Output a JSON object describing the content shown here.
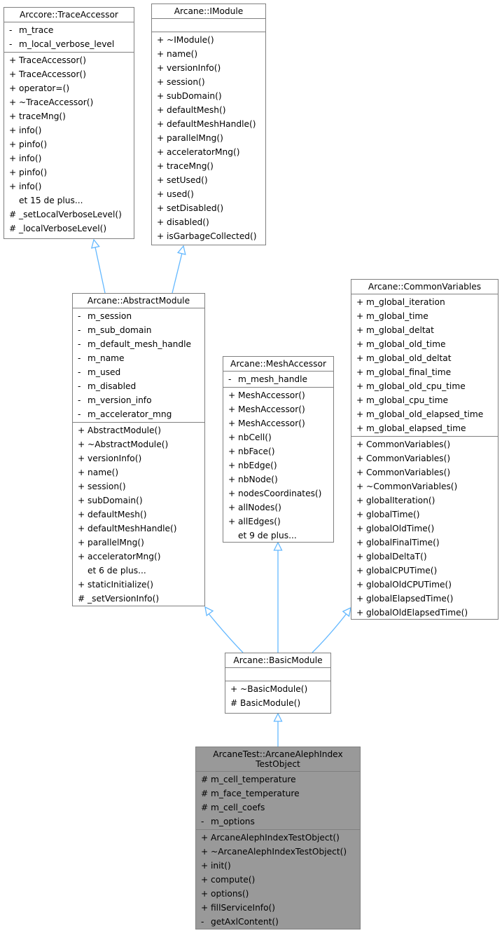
{
  "diagram": {
    "edge_color": "#63b8ff",
    "classes": {
      "trace_accessor": {
        "title": "Arccore::TraceAccessor",
        "attributes": [
          {
            "vis": "-",
            "name": "m_trace"
          },
          {
            "vis": "-",
            "name": "m_local_verbose_level"
          }
        ],
        "methods": [
          {
            "vis": "+",
            "name": "TraceAccessor()"
          },
          {
            "vis": "+",
            "name": "TraceAccessor()"
          },
          {
            "vis": "+",
            "name": "operator=()"
          },
          {
            "vis": "+",
            "name": "~TraceAccessor()"
          },
          {
            "vis": "+",
            "name": "traceMng()"
          },
          {
            "vis": "+",
            "name": "info()"
          },
          {
            "vis": "+",
            "name": "pinfo()"
          },
          {
            "vis": "+",
            "name": "info()"
          },
          {
            "vis": "+",
            "name": "pinfo()"
          },
          {
            "vis": "+",
            "name": "info()"
          },
          {
            "vis": "",
            "name": "et 15 de plus..."
          },
          {
            "vis": "#",
            "name": "_setLocalVerboseLevel()"
          },
          {
            "vis": "#",
            "name": "_localVerboseLevel()"
          }
        ]
      },
      "imodule": {
        "title": "Arcane::IModule",
        "attributes": [],
        "methods": [
          {
            "vis": "+",
            "name": "~IModule()"
          },
          {
            "vis": "+",
            "name": "name()"
          },
          {
            "vis": "+",
            "name": "versionInfo()"
          },
          {
            "vis": "+",
            "name": "session()"
          },
          {
            "vis": "+",
            "name": "subDomain()"
          },
          {
            "vis": "+",
            "name": "defaultMesh()"
          },
          {
            "vis": "+",
            "name": "defaultMeshHandle()"
          },
          {
            "vis": "+",
            "name": "parallelMng()"
          },
          {
            "vis": "+",
            "name": "acceleratorMng()"
          },
          {
            "vis": "+",
            "name": "traceMng()"
          },
          {
            "vis": "+",
            "name": "setUsed()"
          },
          {
            "vis": "+",
            "name": "used()"
          },
          {
            "vis": "+",
            "name": "setDisabled()"
          },
          {
            "vis": "+",
            "name": "disabled()"
          },
          {
            "vis": "+",
            "name": "isGarbageCollected()"
          }
        ]
      },
      "abstract_module": {
        "title": "Arcane::AbstractModule",
        "attributes": [
          {
            "vis": "-",
            "name": "m_session"
          },
          {
            "vis": "-",
            "name": "m_sub_domain"
          },
          {
            "vis": "-",
            "name": "m_default_mesh_handle"
          },
          {
            "vis": "-",
            "name": "m_name"
          },
          {
            "vis": "-",
            "name": "m_used"
          },
          {
            "vis": "-",
            "name": "m_disabled"
          },
          {
            "vis": "-",
            "name": "m_version_info"
          },
          {
            "vis": "-",
            "name": "m_accelerator_mng"
          }
        ],
        "methods": [
          {
            "vis": "+",
            "name": "AbstractModule()"
          },
          {
            "vis": "+",
            "name": "~AbstractModule()"
          },
          {
            "vis": "+",
            "name": "versionInfo()"
          },
          {
            "vis": "+",
            "name": "name()"
          },
          {
            "vis": "+",
            "name": "session()"
          },
          {
            "vis": "+",
            "name": "subDomain()"
          },
          {
            "vis": "+",
            "name": "defaultMesh()"
          },
          {
            "vis": "+",
            "name": "defaultMeshHandle()"
          },
          {
            "vis": "+",
            "name": "parallelMng()"
          },
          {
            "vis": "+",
            "name": "acceleratorMng()"
          },
          {
            "vis": "",
            "name": "et 6 de plus..."
          },
          {
            "vis": "+",
            "name": "staticInitialize()"
          },
          {
            "vis": "#",
            "name": "_setVersionInfo()"
          }
        ]
      },
      "mesh_accessor": {
        "title": "Arcane::MeshAccessor",
        "attributes": [
          {
            "vis": "-",
            "name": "m_mesh_handle"
          }
        ],
        "methods": [
          {
            "vis": "+",
            "name": "MeshAccessor()"
          },
          {
            "vis": "+",
            "name": "MeshAccessor()"
          },
          {
            "vis": "+",
            "name": "MeshAccessor()"
          },
          {
            "vis": "+",
            "name": "nbCell()"
          },
          {
            "vis": "+",
            "name": "nbFace()"
          },
          {
            "vis": "+",
            "name": "nbEdge()"
          },
          {
            "vis": "+",
            "name": "nbNode()"
          },
          {
            "vis": "+",
            "name": "nodesCoordinates()"
          },
          {
            "vis": "+",
            "name": "allNodes()"
          },
          {
            "vis": "+",
            "name": "allEdges()"
          },
          {
            "vis": "",
            "name": "et 9 de plus..."
          }
        ]
      },
      "common_variables": {
        "title": "Arcane::CommonVariables",
        "attributes": [
          {
            "vis": "+",
            "name": "m_global_iteration"
          },
          {
            "vis": "+",
            "name": "m_global_time"
          },
          {
            "vis": "+",
            "name": "m_global_deltat"
          },
          {
            "vis": "+",
            "name": "m_global_old_time"
          },
          {
            "vis": "+",
            "name": "m_global_old_deltat"
          },
          {
            "vis": "+",
            "name": "m_global_final_time"
          },
          {
            "vis": "+",
            "name": "m_global_old_cpu_time"
          },
          {
            "vis": "+",
            "name": "m_global_cpu_time"
          },
          {
            "vis": "+",
            "name": "m_global_old_elapsed_time"
          },
          {
            "vis": "+",
            "name": "m_global_elapsed_time"
          }
        ],
        "methods": [
          {
            "vis": "+",
            "name": "CommonVariables()"
          },
          {
            "vis": "+",
            "name": "CommonVariables()"
          },
          {
            "vis": "+",
            "name": "CommonVariables()"
          },
          {
            "vis": "+",
            "name": "~CommonVariables()"
          },
          {
            "vis": "+",
            "name": "globalIteration()"
          },
          {
            "vis": "+",
            "name": "globalTime()"
          },
          {
            "vis": "+",
            "name": "globalOldTime()"
          },
          {
            "vis": "+",
            "name": "globalFinalTime()"
          },
          {
            "vis": "+",
            "name": "globalDeltaT()"
          },
          {
            "vis": "+",
            "name": "globalCPUTime()"
          },
          {
            "vis": "+",
            "name": "globalOldCPUTime()"
          },
          {
            "vis": "+",
            "name": "globalElapsedTime()"
          },
          {
            "vis": "+",
            "name": "globalOldElapsedTime()"
          }
        ]
      },
      "basic_module": {
        "title": "Arcane::BasicModule",
        "attributes": [],
        "methods": [
          {
            "vis": "+",
            "name": "~BasicModule()"
          },
          {
            "vis": "#",
            "name": "BasicModule()"
          }
        ]
      },
      "test_object": {
        "title": "ArcaneTest::ArcaneAlephIndex\nTestObject",
        "attributes": [
          {
            "vis": "#",
            "name": "m_cell_temperature"
          },
          {
            "vis": "#",
            "name": "m_face_temperature"
          },
          {
            "vis": "#",
            "name": "m_cell_coefs"
          },
          {
            "vis": "-",
            "name": "m_options"
          }
        ],
        "methods": [
          {
            "vis": "+",
            "name": "ArcaneAlephIndexTestObject()"
          },
          {
            "vis": "+",
            "name": "~ArcaneAlephIndexTestObject()"
          },
          {
            "vis": "+",
            "name": "init()"
          },
          {
            "vis": "+",
            "name": "compute()"
          },
          {
            "vis": "+",
            "name": "options()"
          },
          {
            "vis": "+",
            "name": "fillServiceInfo()"
          },
          {
            "vis": "-",
            "name": "getAxlContent()"
          }
        ]
      }
    },
    "inheritance": [
      {
        "child": "abstract_module",
        "parent": "trace_accessor"
      },
      {
        "child": "abstract_module",
        "parent": "imodule"
      },
      {
        "child": "basic_module",
        "parent": "abstract_module"
      },
      {
        "child": "basic_module",
        "parent": "mesh_accessor"
      },
      {
        "child": "basic_module",
        "parent": "common_variables"
      },
      {
        "child": "test_object",
        "parent": "basic_module"
      }
    ]
  }
}
